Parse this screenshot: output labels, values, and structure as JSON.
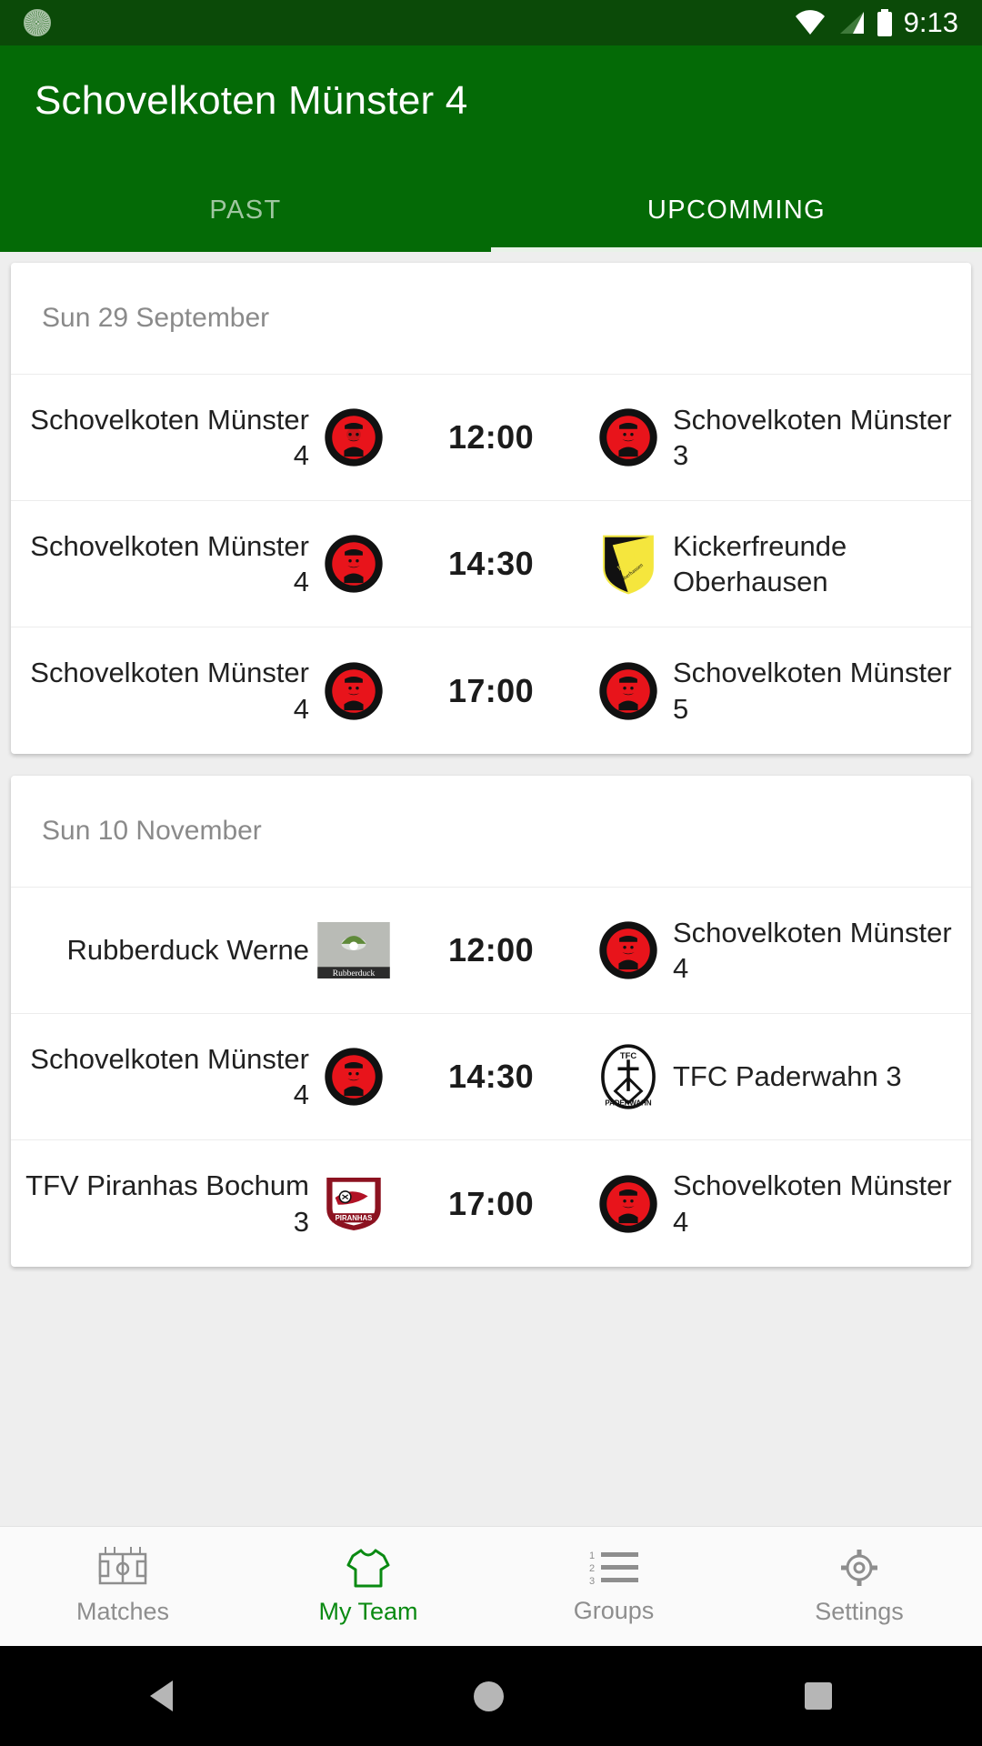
{
  "statusbar": {
    "time": "9:13",
    "icons": [
      "app-notification-icon",
      "wifi-icon",
      "signal-icon",
      "battery-icon"
    ]
  },
  "appbar": {
    "title": "Schovelkoten Münster 4",
    "accent_color": "#046a06",
    "statusbar_color": "#0b4a08"
  },
  "tabs": [
    {
      "label": "PAST",
      "active": false
    },
    {
      "label": "UPCOMMING",
      "active": true
    }
  ],
  "cards": [
    {
      "date": "Sun 29 September",
      "matches": [
        {
          "home": "Schovelkoten Münster 4",
          "home_crest": "schovelkoten-crest",
          "time": "12:00",
          "away": "Schovelkoten Münster 3",
          "away_crest": "schovelkoten-crest"
        },
        {
          "home": "Schovelkoten Münster 4",
          "home_crest": "schovelkoten-crest",
          "time": "14:30",
          "away": "Kickerfreunde Oberhausen",
          "away_crest": "kickerfreunde-crest"
        },
        {
          "home": "Schovelkoten Münster 4",
          "home_crest": "schovelkoten-crest",
          "time": "17:00",
          "away": "Schovelkoten Münster 5",
          "away_crest": "schovelkoten-crest"
        }
      ]
    },
    {
      "date": "Sun 10 November",
      "matches": [
        {
          "home": "Rubberduck Werne",
          "home_crest": "rubberduck-crest",
          "time": "12:00",
          "away": "Schovelkoten Münster 4",
          "away_crest": "schovelkoten-crest"
        },
        {
          "home": "Schovelkoten Münster 4",
          "home_crest": "schovelkoten-crest",
          "time": "14:30",
          "away": "TFC Paderwahn 3",
          "away_crest": "paderwahn-crest"
        },
        {
          "home": "TFV Piranhas Bochum 3",
          "home_crest": "piranhas-crest",
          "time": "17:00",
          "away": "Schovelkoten Münster 4",
          "away_crest": "schovelkoten-crest"
        }
      ]
    }
  ],
  "bottomnav": {
    "active_color": "#0a8a12",
    "inactive_color": "#8e8e8e",
    "items": [
      {
        "label": "Matches",
        "icon": "pitch-icon",
        "active": false
      },
      {
        "label": "My Team",
        "icon": "shirt-icon",
        "active": true
      },
      {
        "label": "Groups",
        "icon": "list-numbered-icon",
        "active": false
      },
      {
        "label": "Settings",
        "icon": "gear-icon",
        "active": false
      }
    ]
  },
  "sysnav": {
    "items": [
      {
        "name": "back",
        "icon": "triangle-back-icon"
      },
      {
        "name": "home",
        "icon": "circle-home-icon"
      },
      {
        "name": "recents",
        "icon": "square-recents-icon"
      }
    ]
  }
}
